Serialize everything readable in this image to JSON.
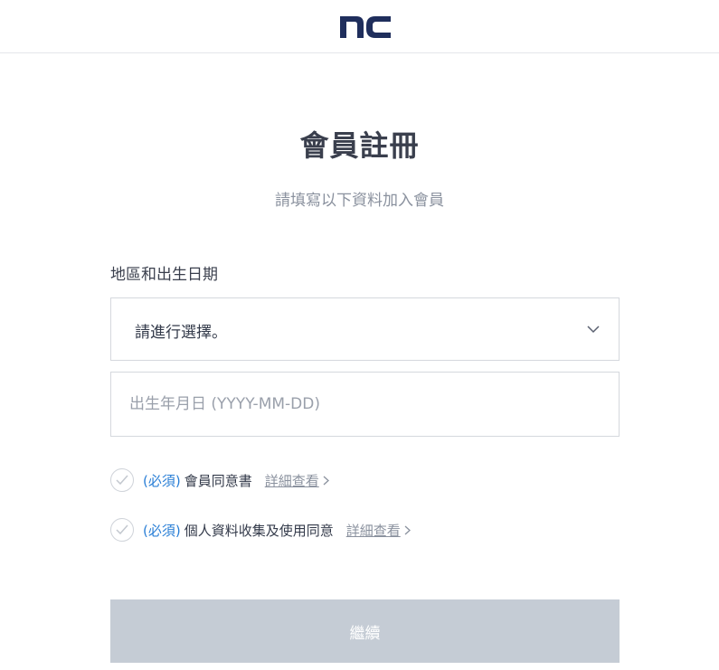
{
  "brand": {
    "logo_text": "nc",
    "logo_color": "#1f2e5c"
  },
  "page": {
    "title": "會員註冊",
    "subtitle": "請填寫以下資料加入會員"
  },
  "form": {
    "section_label": "地區和出生日期",
    "region_select": {
      "selected_value": "請進行選擇。",
      "icon": "chevron-down-icon"
    },
    "birthdate": {
      "value": "",
      "placeholder": "出生年月日 (YYYY-MM-DD)"
    }
  },
  "agreements": [
    {
      "required_label": "(必須)",
      "text": "會員同意書",
      "link_label": "詳細查看"
    },
    {
      "required_label": "(必須)",
      "text": "個人資料收集及使用同意",
      "link_label": "詳細查看"
    }
  ],
  "actions": {
    "continue_label": "繼續"
  },
  "colors": {
    "accent": "#2a7fd6",
    "button_disabled": "#c5ccd5",
    "border": "#d5d8dd"
  }
}
